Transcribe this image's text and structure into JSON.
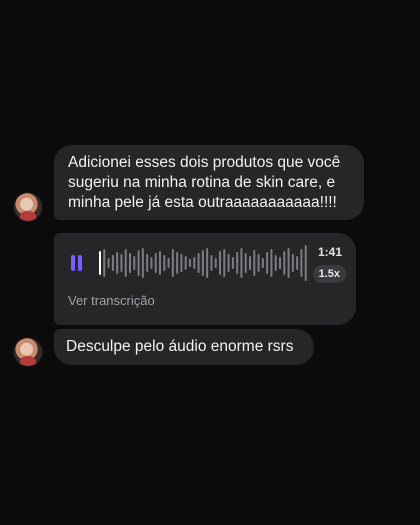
{
  "messages": {
    "text1": "Adicionei esses dois produtos que você sugeriu na minha rotina de skin care, e minha pele já esta outraaaaaaaaaaa!!!!",
    "audio": {
      "duration": "1:41",
      "speed": "1.5x",
      "transcript_label": "Ver transcrição",
      "progress": 0.02
    },
    "text2": "Desculpe pelo áudio enorme rsrs"
  },
  "colors": {
    "background": "#0b0b0c",
    "bubble": "#262629",
    "accent": "#7a5cff",
    "wave_played": "#ffffff",
    "wave_unplayed": "#7c7c82"
  },
  "icons": {
    "pause": "pause-icon",
    "avatar": "avatar"
  }
}
